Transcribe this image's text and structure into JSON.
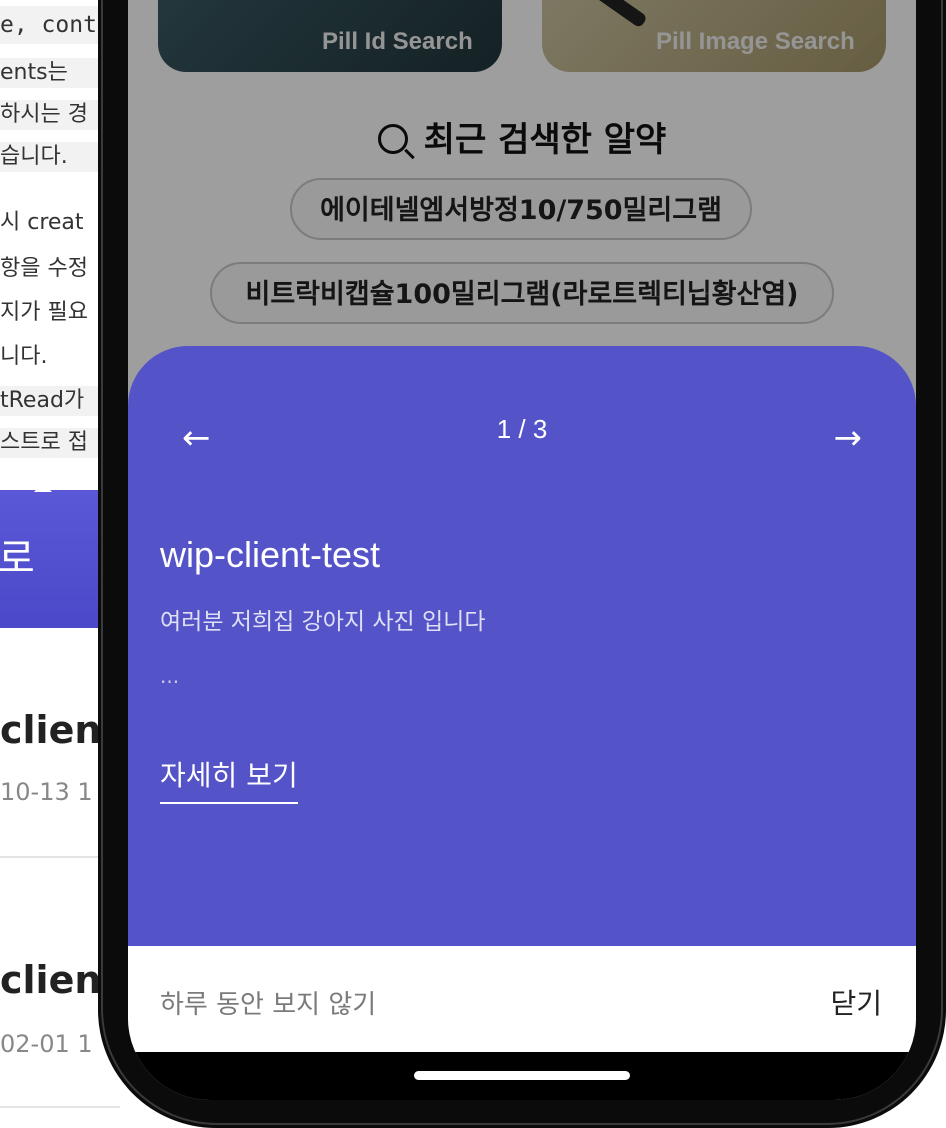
{
  "background_doc": {
    "code_lines": [
      "e, cont"
    ],
    "text_lines": [
      "ents는 ",
      "하시는 경",
      "습니다.",
      "시 creat",
      "항을 수정",
      "지가 필요",
      "니다.",
      "tRead가",
      "스트로 접"
    ],
    "button_fragment": "로",
    "posts": [
      {
        "title": "client",
        "date": "10-13 1"
      },
      {
        "title": "client",
        "date": "02-01 1"
      }
    ]
  },
  "app": {
    "cards": [
      {
        "label": "Pill Id Search"
      },
      {
        "label": "Pill Image Search"
      }
    ],
    "recent": {
      "title": "최근 검색한 알약",
      "chips": [
        "에이테넬엠서방정10/750밀리그램",
        "비트락비캡슐100밀리그램(라로트렉티닙황산염)"
      ]
    }
  },
  "popup": {
    "prev_arrow": "←",
    "next_arrow": "→",
    "pager": "1 / 3",
    "title": "wip-client-test",
    "body": "여러분 저희집 강아지 사진 입니다",
    "ellipsis": "...",
    "detail_link": "자세히 보기",
    "dismiss_today": "하루 동안 보지 않기",
    "close": "닫기"
  },
  "colors": {
    "popup_bg": "#5453c8",
    "button_accent": "#4b49c9"
  }
}
